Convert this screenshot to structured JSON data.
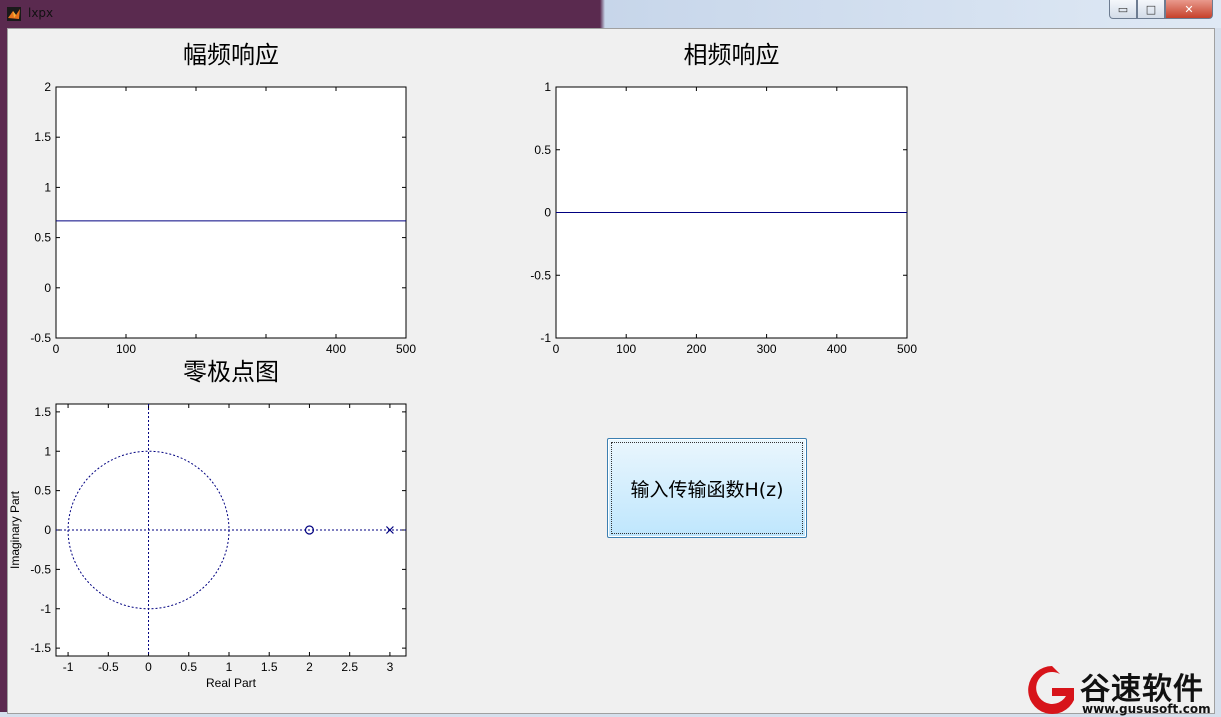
{
  "window": {
    "title": "lxpx"
  },
  "window_controls": {
    "minimize": "▭",
    "maximize": "□",
    "close": "✕"
  },
  "button": {
    "label": "输入传输函数H(z)"
  },
  "watermark": {
    "brand": "谷速软件",
    "url": "www.gususoft.com"
  },
  "colors": {
    "trace": "#000080",
    "client_bg": "#f0f0f0",
    "button_top": "#eaf6fd",
    "button_bottom": "#bee6fd"
  },
  "chart_data": [
    {
      "type": "line",
      "title": "幅频响应",
      "xlabel": "",
      "ylabel": "",
      "xlim": [
        0,
        500
      ],
      "ylim": [
        -0.5,
        2
      ],
      "xticks": [
        0,
        100,
        200,
        300,
        400,
        500
      ],
      "yticks": [
        -0.5,
        0,
        0.5,
        1,
        1.5,
        2
      ],
      "xtick_labels": [
        "0",
        "100",
        "",
        "",
        "400",
        "500"
      ],
      "ytick_labels": [
        "-0.5",
        "0",
        "0.5",
        "1",
        "1.5",
        "2"
      ],
      "series": [
        {
          "x": [
            0,
            500
          ],
          "y": [
            0.667,
            0.667
          ]
        }
      ],
      "grid": false
    },
    {
      "type": "line",
      "title": "相频响应",
      "xlabel": "",
      "ylabel": "",
      "xlim": [
        0,
        500
      ],
      "ylim": [
        -1,
        1
      ],
      "xticks": [
        0,
        100,
        200,
        300,
        400,
        500
      ],
      "yticks": [
        -1,
        -0.5,
        0,
        0.5,
        1
      ],
      "xtick_labels": [
        "0",
        "100",
        "200",
        "300",
        "400",
        "500"
      ],
      "ytick_labels": [
        "-1",
        "-0.5",
        "0",
        "0.5",
        "1"
      ],
      "series": [
        {
          "x": [
            0,
            500
          ],
          "y": [
            0,
            0
          ]
        }
      ],
      "grid": false
    },
    {
      "type": "scatter",
      "title": "零极点图",
      "xlabel": "Real Part",
      "ylabel": "Imaginary Part",
      "xlim": [
        -1.15,
        3.2
      ],
      "ylim": [
        -1.6,
        1.6
      ],
      "xticks": [
        -1,
        -0.5,
        0,
        0.5,
        1,
        1.5,
        2,
        2.5,
        3
      ],
      "yticks": [
        -1.5,
        -1,
        -0.5,
        0,
        0.5,
        1,
        1.5
      ],
      "xtick_labels": [
        "-1",
        "-0.5",
        "0",
        "0.5",
        "1",
        "1.5",
        "2",
        "2.5",
        "3"
      ],
      "ytick_labels": [
        "-1.5",
        "-1",
        "-0.5",
        "0",
        "0.5",
        "1",
        "1.5"
      ],
      "unit_circle": true,
      "zeros": [
        {
          "re": 2,
          "im": 0
        }
      ],
      "poles": [
        {
          "re": 3,
          "im": 0
        }
      ],
      "grid": false
    }
  ]
}
